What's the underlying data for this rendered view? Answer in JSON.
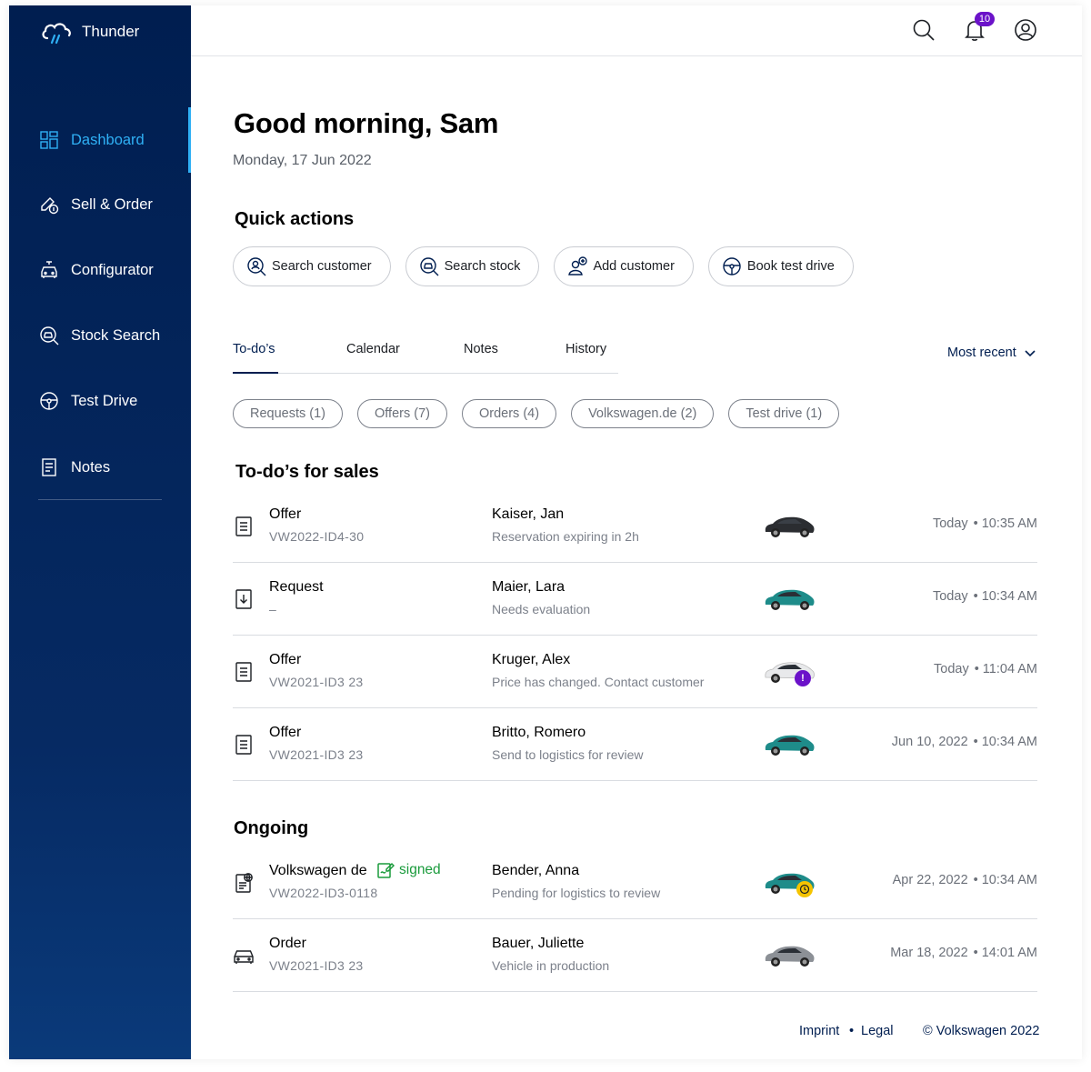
{
  "app": {
    "name": "Thunder"
  },
  "sidebar": {
    "items": [
      {
        "label": "Dashboard"
      },
      {
        "label": "Sell & Order"
      },
      {
        "label": "Configurator"
      },
      {
        "label": "Stock Search"
      },
      {
        "label": "Test Drive"
      },
      {
        "label": "Notes"
      }
    ],
    "active_index": 0
  },
  "header": {
    "notification_count": "10"
  },
  "greeting": {
    "title": "Good morning, Sam",
    "date": "Monday, 17 Jun 2022"
  },
  "quick_actions": {
    "title": "Quick actions",
    "buttons": [
      {
        "label": "Search customer",
        "icon": "search-customer-icon"
      },
      {
        "label": "Search stock",
        "icon": "search-stock-icon"
      },
      {
        "label": "Add customer",
        "icon": "add-customer-icon"
      },
      {
        "label": "Book test drive",
        "icon": "steering-wheel-icon"
      }
    ]
  },
  "tabs": [
    {
      "label": "To-do’s"
    },
    {
      "label": "Calendar"
    },
    {
      "label": "Notes"
    },
    {
      "label": "History"
    }
  ],
  "sort": {
    "label": "Most recent"
  },
  "filters": [
    {
      "label": "Requests (1)"
    },
    {
      "label": "Offers (7)"
    },
    {
      "label": "Orders (4)"
    },
    {
      "label": "Volkswagen.de (2)"
    },
    {
      "label": "Test drive (1)"
    }
  ],
  "todos": {
    "title": "To-do’s for sales",
    "rows": [
      {
        "type": "Offer",
        "ref": "VW2022-ID4-30",
        "name": "Kaiser, Jan",
        "status": "Reservation expiring in 2h",
        "day": "Today",
        "time": "10:35 AM",
        "car_color": "#2b2d31"
      },
      {
        "type": "Request",
        "ref": "–",
        "name": "Maier, Lara",
        "status": "Needs evaluation",
        "day": "Today",
        "time": "10:34 AM",
        "car_color": "#1e8c8a"
      },
      {
        "type": "Offer",
        "ref": "VW2021-ID3 23",
        "name": "Kruger, Alex",
        "status": "Price has changed. Contact customer",
        "day": "Today",
        "time": "11:04 AM",
        "car_color": "#e8e9eb",
        "badge": "!"
      },
      {
        "type": "Offer",
        "ref": "VW2021-ID3 23",
        "name": "Britto, Romero",
        "status": "Send to logistics for review",
        "day": "Jun 10, 2022",
        "time": "10:34 AM",
        "car_color": "#1e8c8a"
      }
    ]
  },
  "ongoing": {
    "title": "Ongoing",
    "rows": [
      {
        "type": "Volkswagen de",
        "signed_label": "signed",
        "ref": "VW2022-ID3-0118",
        "name": "Bender, Anna",
        "status": "Pending for logistics to review",
        "day": "Apr 22, 2022",
        "time": "10:34 AM",
        "car_color": "#1e8c8a"
      },
      {
        "type": "Order",
        "ref": "VW2021-ID3 23",
        "name": "Bauer, Juliette",
        "status": "Vehicle in production",
        "day": "Mar 18, 2022",
        "time": "14:01 AM",
        "car_color": "#8c9096"
      }
    ]
  },
  "footer": {
    "imprint": "Imprint",
    "separator": "•",
    "legal": "Legal",
    "copyright": "© Volkswagen 2022"
  },
  "colors": {
    "sidebar": "#001e50",
    "accent": "#2fb0f5",
    "badge": "#6b12c9",
    "signed": "#1a9b3c"
  }
}
